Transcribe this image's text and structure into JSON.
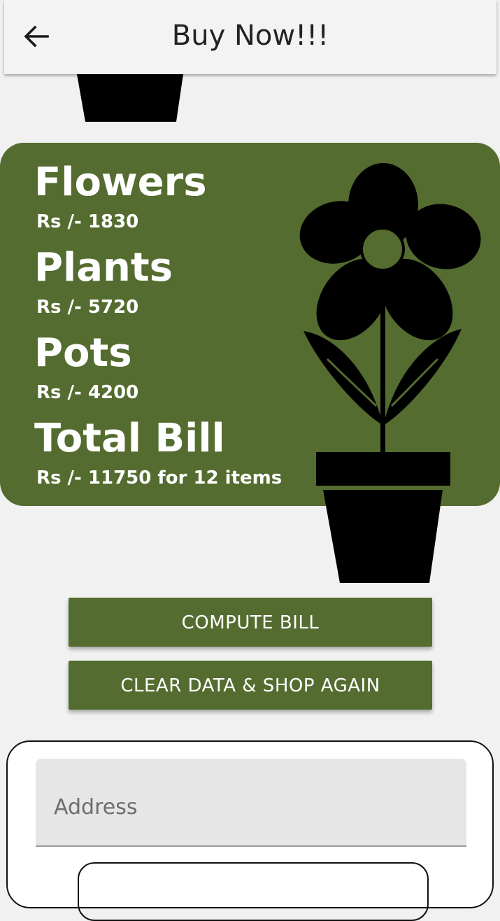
{
  "appbar": {
    "title": "Buy Now!!!",
    "back_icon": "arrow-left-icon"
  },
  "summary": {
    "flowers_label": "Flowers",
    "flowers_price": "Rs /- 1830",
    "plants_label": "Plants",
    "plants_price": "Rs /- 5720",
    "pots_label": "Pots",
    "pots_price": "Rs /- 4200",
    "total_label": "Total Bill",
    "total_value": "Rs /- 11750 for 12 items"
  },
  "actions": {
    "compute_label": "COMPUTE BILL",
    "clear_label": "CLEAR DATA & SHOP AGAIN"
  },
  "form": {
    "address_placeholder": "Address",
    "address_value": ""
  },
  "colors": {
    "accent": "#546c2f",
    "background": "#f1f1f1"
  }
}
